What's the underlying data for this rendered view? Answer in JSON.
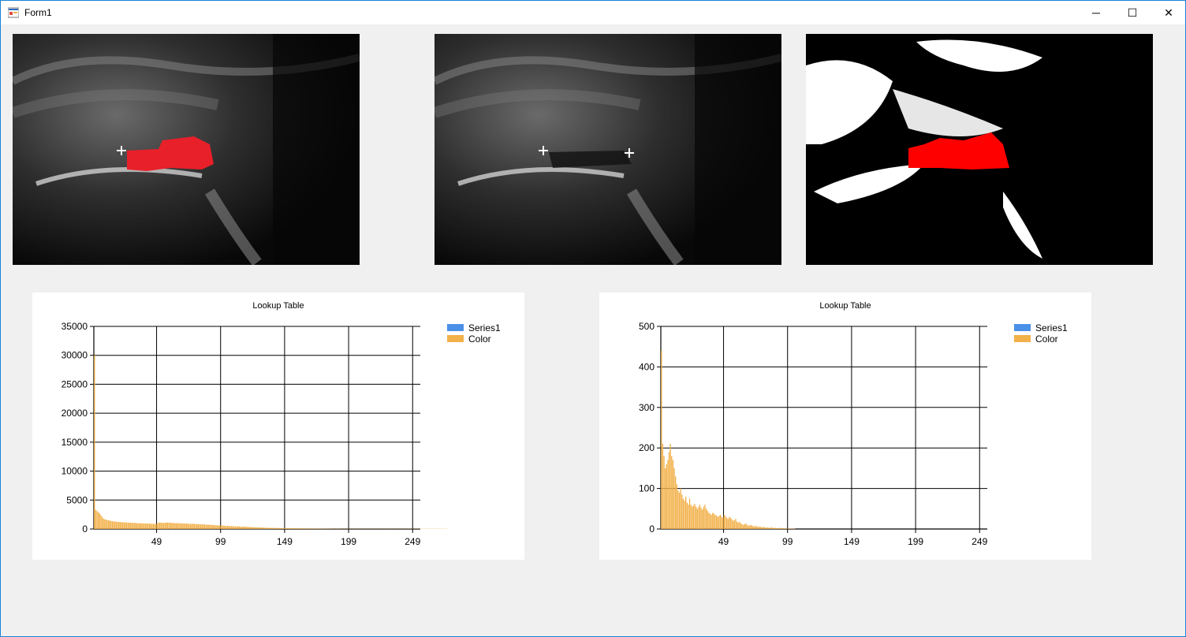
{
  "window": {
    "title": "Form1",
    "minimize_glyph": "─",
    "maximize_glyph": "☐",
    "close_glyph": "✕"
  },
  "images": [
    {
      "name": "ultrasound-overlay",
      "overlay_color": "#e8202a"
    },
    {
      "name": "ultrasound-original"
    },
    {
      "name": "ultrasound-threshold",
      "overlay_color": "#ff0000"
    }
  ],
  "chart_data": [
    {
      "type": "bar",
      "title": "Lookup Table",
      "ylim": [
        0,
        35000
      ],
      "yticks": [
        0,
        5000,
        10000,
        15000,
        20000,
        25000,
        30000,
        35000
      ],
      "xticks": [
        49,
        99,
        149,
        199,
        249
      ],
      "xlim": [
        0,
        255
      ],
      "grid": true,
      "legend_position": "top-right",
      "legend": [
        {
          "name": "Series1",
          "color": "#4a90e8"
        },
        {
          "name": "Color",
          "color": "#f2b14b"
        }
      ],
      "series": [
        {
          "name": "Color",
          "color": "#f2b14b",
          "values": [
            30000,
            3300,
            3100,
            2900,
            2700,
            2400,
            2100,
            1800,
            1700,
            1600,
            1550,
            1500,
            1450,
            1400,
            1350,
            1300,
            1300,
            1250,
            1250,
            1200,
            1200,
            1200,
            1150,
            1150,
            1150,
            1100,
            1100,
            1100,
            1100,
            1050,
            1050,
            1050,
            1050,
            1000,
            1000,
            1000,
            1000,
            1000,
            950,
            950,
            950,
            950,
            950,
            950,
            900,
            900,
            900,
            900,
            900,
            900,
            1100,
            1100,
            1100,
            1050,
            1050,
            1100,
            1100,
            1100,
            1100,
            1100,
            1050,
            1050,
            1050,
            1000,
            1000,
            1000,
            1000,
            1000,
            950,
            950,
            950,
            950,
            950,
            900,
            900,
            900,
            900,
            900,
            900,
            850,
            850,
            850,
            850,
            800,
            800,
            800,
            800,
            750,
            750,
            750,
            750,
            700,
            700,
            700,
            650,
            650,
            650,
            600,
            600,
            600,
            600,
            550,
            550,
            550,
            550,
            500,
            500,
            500,
            500,
            450,
            450,
            450,
            450,
            450,
            400,
            400,
            400,
            400,
            400,
            380,
            360,
            350,
            340,
            330,
            320,
            310,
            300,
            290,
            280,
            270,
            260,
            250,
            240,
            230,
            220,
            210,
            200,
            200,
            200,
            190,
            190,
            180,
            180,
            170,
            170,
            160,
            160,
            150,
            150,
            150,
            140,
            140,
            140,
            130,
            130,
            130,
            120,
            120,
            120,
            110,
            110,
            110,
            100,
            100,
            100,
            100,
            90,
            90,
            90,
            90,
            80,
            80,
            80,
            80,
            70,
            70,
            70,
            70,
            70,
            60,
            60,
            60,
            60,
            60,
            60,
            50,
            50,
            50,
            50,
            50,
            50,
            50,
            50,
            40,
            40,
            40,
            40,
            40,
            40,
            40,
            40,
            40,
            40,
            40,
            40,
            40,
            40,
            40,
            40,
            40,
            40,
            40,
            40,
            40,
            40,
            40,
            40,
            40,
            40,
            40,
            40,
            40,
            40,
            40,
            40,
            40,
            40,
            40,
            40,
            40,
            40,
            40,
            40,
            40,
            40,
            40,
            40,
            40,
            40,
            40,
            40,
            40,
            40,
            40,
            40,
            40,
            40,
            40,
            40,
            40,
            40,
            40,
            40,
            40,
            40,
            40,
            40,
            40,
            40,
            40,
            40,
            40,
            40,
            40,
            40,
            40,
            40,
            40,
            40,
            40,
            40,
            40,
            40,
            40,
            40,
            40
          ]
        }
      ]
    },
    {
      "type": "bar",
      "title": "Lookup Table",
      "ylim": [
        0,
        500
      ],
      "yticks": [
        0,
        100,
        200,
        300,
        400,
        500
      ],
      "xticks": [
        49,
        99,
        149,
        199,
        249
      ],
      "xlim": [
        0,
        255
      ],
      "grid": true,
      "legend_position": "top-right",
      "legend": [
        {
          "name": "Series1",
          "color": "#4a90e8"
        },
        {
          "name": "Color",
          "color": "#f2b14b"
        }
      ],
      "series": [
        {
          "name": "Color",
          "color": "#f2b14b",
          "values": [
            440,
            210,
            180,
            150,
            160,
            170,
            190,
            210,
            180,
            170,
            150,
            130,
            110,
            95,
            90,
            100,
            85,
            75,
            70,
            80,
            65,
            60,
            75,
            60,
            55,
            58,
            62,
            55,
            50,
            55,
            60,
            52,
            48,
            55,
            60,
            50,
            45,
            40,
            38,
            35,
            40,
            38,
            35,
            33,
            30,
            32,
            35,
            30,
            28,
            35,
            32,
            28,
            25,
            30,
            28,
            24,
            20,
            22,
            25,
            18,
            15,
            18,
            14,
            12,
            10,
            12,
            14,
            10,
            8,
            9,
            10,
            8,
            7,
            6,
            8,
            6,
            5,
            6,
            5,
            4,
            5,
            4,
            3,
            4,
            3,
            3,
            4,
            3,
            2,
            3,
            2,
            2,
            3,
            2,
            2,
            2,
            1,
            2,
            1,
            1,
            1,
            1,
            1,
            1,
            1,
            0,
            0,
            0,
            0,
            0,
            0,
            0,
            0,
            0,
            0,
            0,
            0,
            0,
            0,
            0,
            0,
            0,
            0,
            0,
            0,
            0,
            0,
            0,
            0,
            0,
            0,
            0,
            0,
            0,
            0,
            0,
            0,
            0,
            0,
            0,
            0,
            0,
            0,
            0,
            0,
            0,
            0,
            0,
            0,
            0,
            0,
            0,
            0,
            0,
            0,
            0,
            0,
            0,
            0,
            0,
            0,
            0,
            0,
            0,
            0,
            0,
            0,
            0,
            0,
            0,
            0,
            0,
            0,
            0,
            0,
            0,
            0,
            0,
            0,
            0,
            0,
            0,
            0,
            0,
            0,
            0,
            0,
            0,
            0,
            0,
            0,
            0,
            0,
            0,
            0,
            0,
            0,
            0,
            0,
            0,
            0,
            0,
            0,
            0,
            0,
            0,
            0,
            0,
            0,
            0,
            0,
            0,
            0,
            0,
            0,
            0,
            0,
            0,
            0,
            0,
            0,
            0,
            0,
            0,
            0,
            0,
            0,
            0,
            0,
            0,
            0,
            0,
            0,
            0,
            0,
            0,
            0,
            0,
            0,
            0,
            0,
            0,
            0,
            0,
            0,
            0,
            0,
            0,
            0,
            0,
            0,
            0,
            0,
            0,
            0,
            0,
            0,
            0,
            0,
            0,
            0,
            0,
            0,
            0,
            0,
            0,
            0,
            0,
            0
          ]
        }
      ]
    }
  ]
}
